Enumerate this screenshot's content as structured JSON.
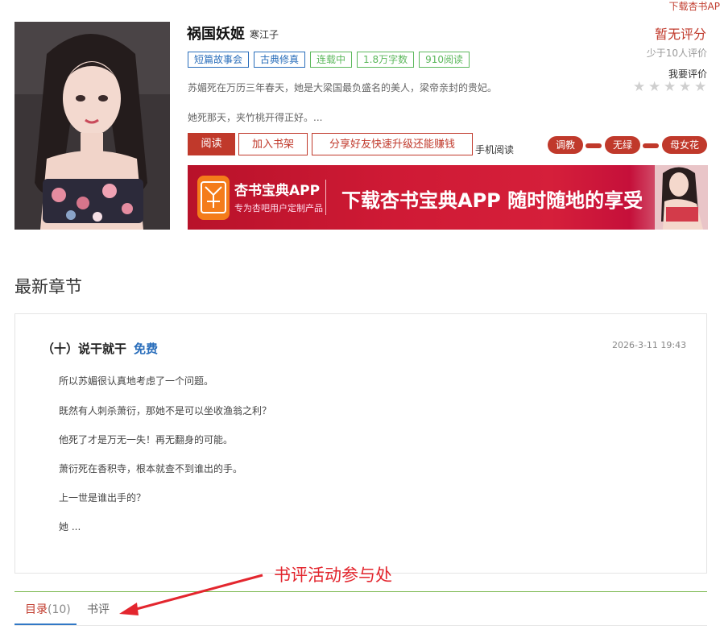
{
  "header": {
    "top_link": "下载杏书AP"
  },
  "book": {
    "title": "祸国妖姬",
    "author": "寒江子",
    "tags": [
      {
        "label": "短篇故事会",
        "style": "blue"
      },
      {
        "label": "古典修真",
        "style": "blue"
      },
      {
        "label": "连载中",
        "style": "green"
      },
      {
        "label": "1.8万字数",
        "style": "green"
      },
      {
        "label": "910阅读",
        "style": "green"
      }
    ],
    "desc_line1": "苏媚死在万历三年春天，她是大梁国最负盛名的美人，梁帝亲封的贵妃。",
    "desc_line2": "她死那天，夹竹桃开得正好。..."
  },
  "rating": {
    "score": "暂无评分",
    "sub": "少于10人评价",
    "rate_label": "我要评价",
    "stars": 5
  },
  "actions": {
    "read": "阅读",
    "add_shelf": "加入书架",
    "share": "分享好友快速升级还能赚钱",
    "mobile": "手机阅读"
  },
  "pills": [
    "调教",
    "无绿",
    "母女花"
  ],
  "banner": {
    "app_name": "杏书宝典APP",
    "app_sub": "专为杏吧用户定制产品",
    "slogan": "下载杏书宝典APP 随时随地的享受",
    "colors": {
      "primary": "#cf1a35",
      "icon": "#f47c1a"
    }
  },
  "latest": {
    "section_title": "最新章节",
    "chapter_title": "（十）说干就干",
    "free": "免费",
    "date": "2026-3-11 19:43",
    "paragraphs": [
      "所以苏媚很认真地考虑了一个问题。",
      "既然有人刺杀萧衍，那她不是可以坐收渔翁之利？",
      "他死了才是万无一失！再无翻身的可能。",
      "萧衍死在香积寺，根本就查不到谁出的手。",
      "上一世是谁出手的？",
      "她 ..."
    ]
  },
  "tabs": {
    "toc_label": "目录",
    "toc_count": "(10)",
    "review_label": "书评"
  },
  "annotation": "书评活动参与处",
  "colors": {
    "accent": "#c0392b",
    "link": "#2a6ebb",
    "tag_green": "#5cb85c",
    "tab_line": "#7ab84e"
  }
}
